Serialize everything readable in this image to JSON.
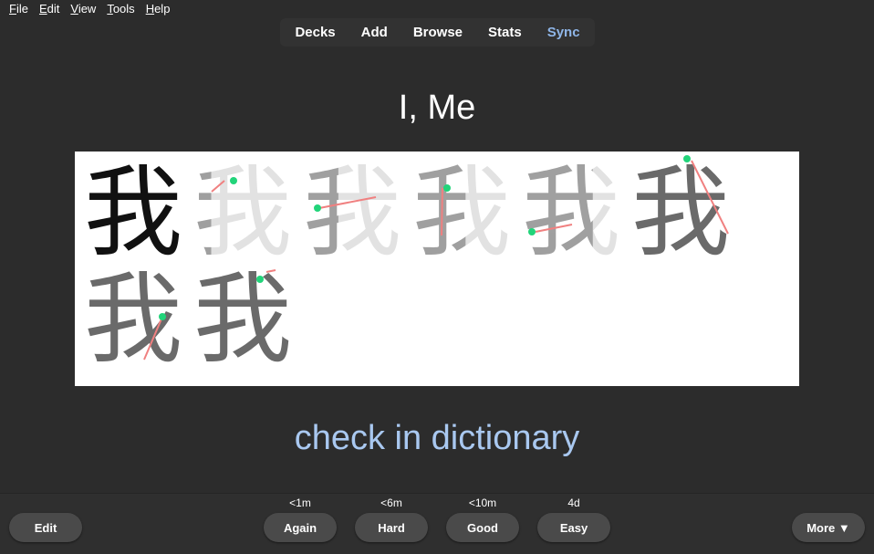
{
  "menubar": {
    "items": [
      {
        "accel": "F",
        "rest": "ile"
      },
      {
        "accel": "E",
        "rest": "dit"
      },
      {
        "accel": "V",
        "rest": "iew"
      },
      {
        "accel": "T",
        "rest": "ools"
      },
      {
        "accel": "H",
        "rest": "elp"
      }
    ]
  },
  "nav": {
    "decks": "Decks",
    "add": "Add",
    "browse": "Browse",
    "stats": "Stats",
    "sync": "Sync",
    "sync_color": "#8fb6e8"
  },
  "card": {
    "title": "I, Me",
    "character": "我",
    "stroke_frames": 8,
    "dictionary_link": "check in dictionary",
    "link_color": "#a9c8f0"
  },
  "answer_buttons": {
    "edit": "Edit",
    "again": {
      "label": "Again",
      "interval": "<1m"
    },
    "hard": {
      "label": "Hard",
      "interval": "<6m"
    },
    "good": {
      "label": "Good",
      "interval": "<10m"
    },
    "easy": {
      "label": "Easy",
      "interval": "4d"
    },
    "more": "More ▼"
  },
  "colors": {
    "background": "#2c2c2c",
    "button": "#4a4a4a",
    "start_dot": "#22d47a",
    "arrow": "#f08080"
  }
}
